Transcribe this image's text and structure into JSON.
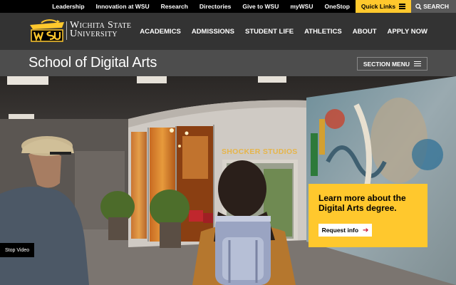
{
  "utility_bar": {
    "links": [
      "Leadership",
      "Innovation at WSU",
      "Research",
      "Directories",
      "Give to WSU",
      "myWSU",
      "OneStop"
    ],
    "quick_links_label": "Quick Links",
    "search_label": "SEARCH"
  },
  "header": {
    "university_line1": "Wichita State",
    "university_line2": "University",
    "nav": [
      "ACADEMICS",
      "ADMISSIONS",
      "STUDENT LIFE",
      "ATHLETICS",
      "ABOUT",
      "APPLY NOW"
    ]
  },
  "section": {
    "title": "School of Digital Arts",
    "menu_label": "SECTION MENU"
  },
  "hero": {
    "sign_text": "SHOCKER STUDIOS",
    "cta_text": "Learn more about the Digital Arts degree.",
    "cta_button": "Request info",
    "stop_video": "Stop Video"
  },
  "colors": {
    "wsu_gold": "#ffc82d",
    "black": "#000000",
    "header_gray": "#333333",
    "section_gray": "#4d4d4d"
  }
}
